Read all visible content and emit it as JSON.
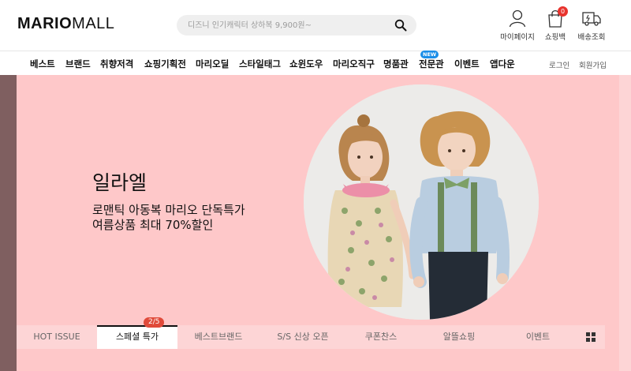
{
  "header": {
    "logo": {
      "part1": "MARIO",
      "part2": "MALL"
    },
    "search": {
      "placeholder": "디즈니 인기캐릭터 상하복 9,900원~"
    },
    "utils": [
      {
        "icon": "user-icon",
        "label": "마이페이지"
      },
      {
        "icon": "shopping-bag-icon",
        "label": "쇼핑백",
        "count": "0"
      },
      {
        "icon": "delivery-truck-icon",
        "label": "배송조회"
      }
    ]
  },
  "nav": {
    "items": [
      "베스트",
      "브랜드",
      "취향저격",
      "쇼핑기획전",
      "마리오딜",
      "스타일태그",
      "쇼윈도우",
      "마리오직구",
      "명품관",
      "전문관",
      "이벤트",
      "앱다운"
    ],
    "new_badge": "NEW",
    "login": "로그인",
    "signup": "회원가입"
  },
  "hero": {
    "title": "일라엘",
    "subtitle_line1": "로맨틱 아동복 마리오 단독특가",
    "subtitle_line2": "여름상품 최대 70%할인",
    "photo_icon": "kids-photo"
  },
  "tabs": {
    "items": [
      "HOT ISSUE",
      "스페셜 특가",
      "베스트브랜드",
      "S/S 신상 오픈",
      "쿠폰찬스",
      "알뜰쇼핑",
      "이벤트"
    ],
    "active_index": 1,
    "counter": "2/5",
    "grid_icon": "grid-icon"
  },
  "colors": {
    "hero_bg": "#fec8c9",
    "accent_red": "#e8332d",
    "new_blue": "#1b8ee8"
  }
}
